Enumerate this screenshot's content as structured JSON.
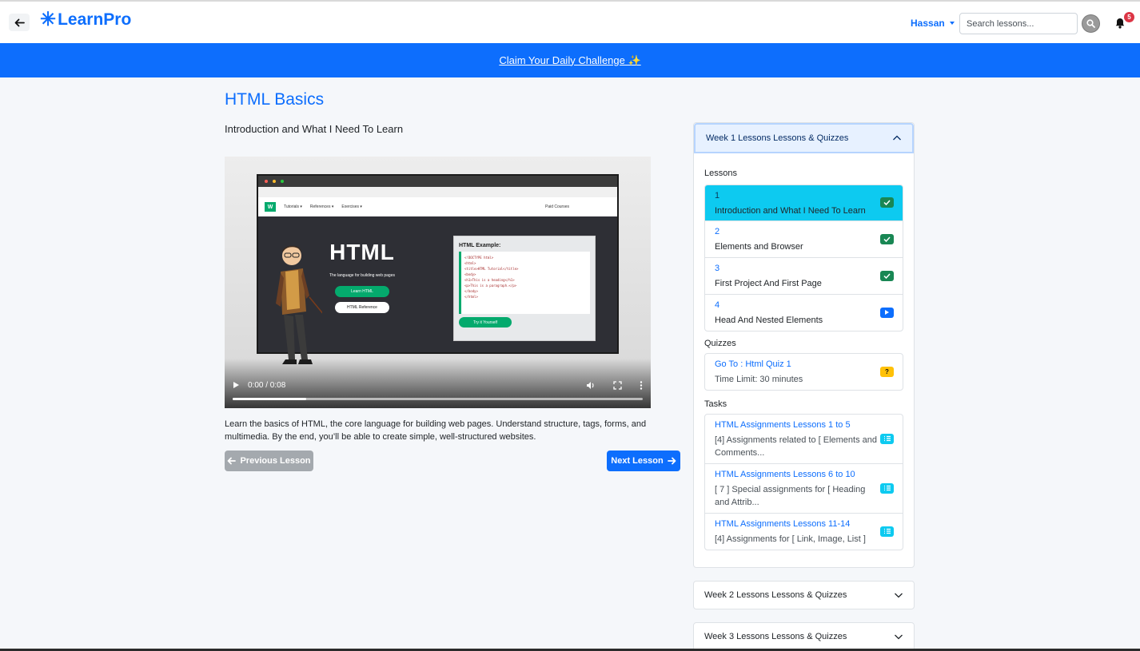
{
  "nav": {
    "brand": "LearnPro",
    "user_name": "Hassan",
    "search_placeholder": "Search lessons...",
    "notifications_count": "5"
  },
  "banner": {
    "text": "Claim Your Daily Challenge ✨"
  },
  "course": {
    "title": "HTML Basics",
    "lesson_title": "Introduction and What I Need To Learn",
    "description": "Learn the basics of HTML, the core language for building web pages. Understand structure, tags, forms, and multimedia. By the end, you’ll be able to create simple, well-structured websites."
  },
  "video": {
    "time": "0:00 / 0:08",
    "progress": 0.18,
    "frame": {
      "nav_items": [
        "Tutorials ▾",
        "References ▾",
        "Exercises ▾"
      ],
      "paid": "Paid Courses",
      "heading": "HTML",
      "tagline": "The language for building web pages",
      "learn_btn": "Learn HTML",
      "ref_btn": "HTML Reference",
      "example_title": "HTML Example:",
      "code": [
        "<!DOCTYPE html>",
        "<html>",
        "<title>HTML Tutorial</title>",
        "<body>",
        "",
        "<h1>This is a heading</h1>",
        "<p>This is a paragraph.</p>",
        "",
        "</body>",
        "</html>"
      ],
      "try_btn": "Try it Yourself"
    }
  },
  "buttons": {
    "previous": "Previous Lesson",
    "next": "Next Lesson"
  },
  "sidebar": {
    "week1_title": "Week 1 Lessons Lessons & Quizzes",
    "lessons_label": "Lessons",
    "lessons": [
      {
        "num": "1",
        "title": "Introduction and What I Need To Learn",
        "status": "done",
        "active": true
      },
      {
        "num": "2",
        "title": "Elements and Browser",
        "status": "done",
        "active": false
      },
      {
        "num": "3",
        "title": "First Project And First Page",
        "status": "done",
        "active": false
      },
      {
        "num": "4",
        "title": "Head And Nested Elements",
        "status": "play",
        "active": false
      }
    ],
    "quizzes_label": "Quizzes",
    "quiz": {
      "title": "Go To : Html Quiz 1",
      "limit": "Time Limit: 30 minutes",
      "icon": "?"
    },
    "tasks_label": "Tasks",
    "tasks": [
      {
        "title": "HTML Assignments Lessons 1 to 5",
        "desc": "[4] Assignments related to [ Elements and Comments..."
      },
      {
        "title": "HTML Assignments Lessons 6 to 10",
        "desc": "[ 7 ] Special assignments for [ Heading and Attrib..."
      },
      {
        "title": "HTML Assignments Lessons 11-14",
        "desc": "[4] Assignments for [ Link, Image, List ]"
      }
    ],
    "week2_title": "Week 2 Lessons Lessons & Quizzes",
    "week3_title": "Week 3 Lessons Lessons & Quizzes"
  },
  "colors": {
    "primary": "#0d6efd",
    "active": "#0dcaf0",
    "done": "#198754",
    "quiz": "#ffc107"
  }
}
